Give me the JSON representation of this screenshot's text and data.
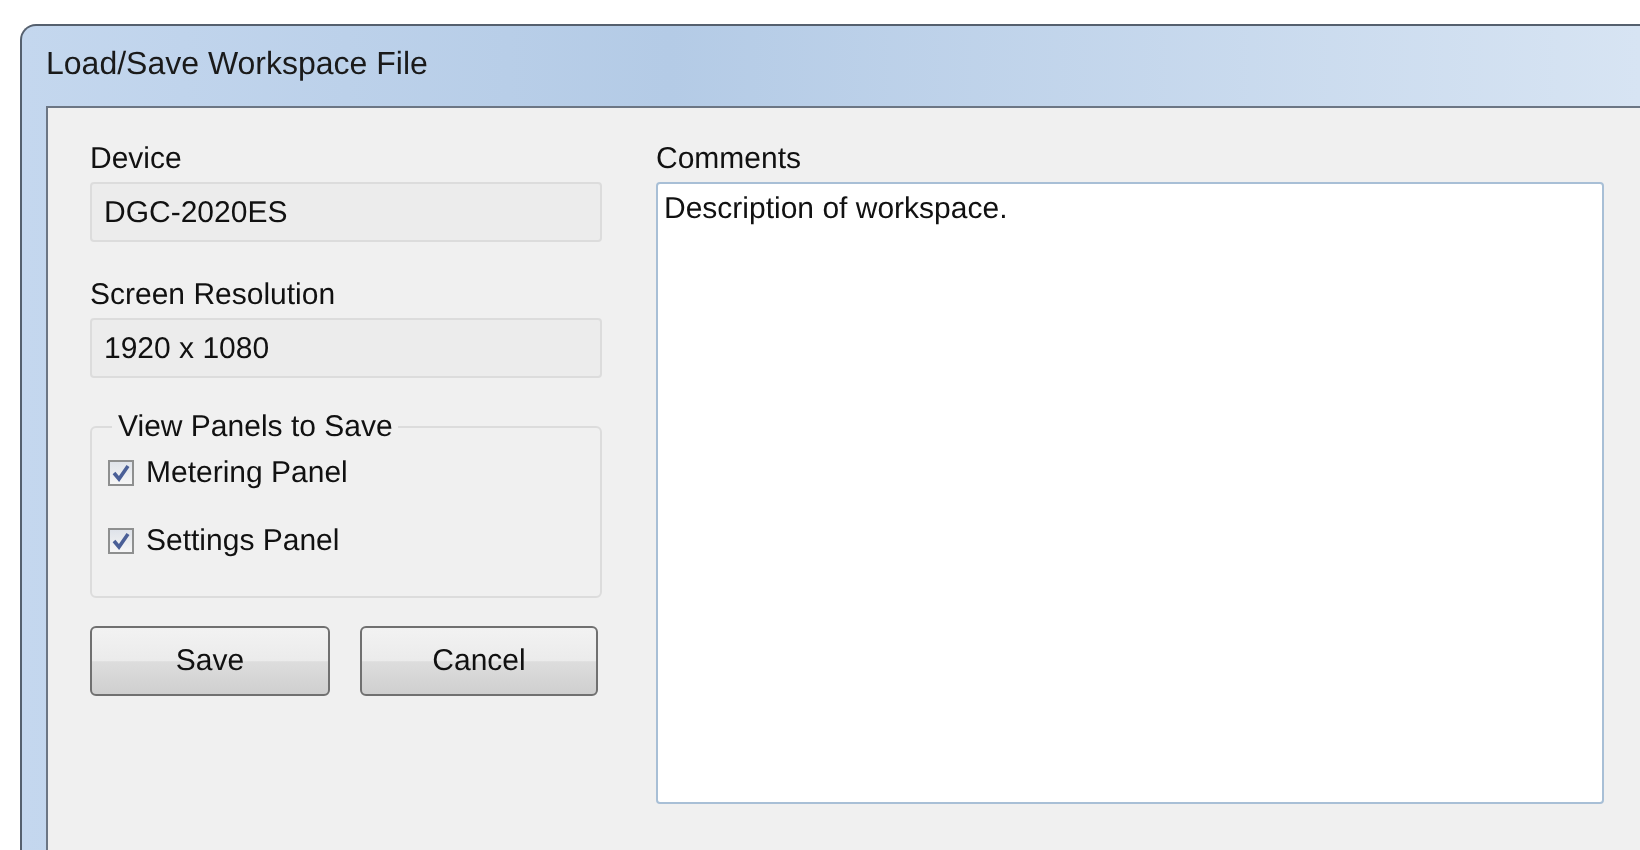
{
  "window": {
    "title": "Load/Save Workspace File"
  },
  "device": {
    "label": "Device",
    "value": "DGC-2020ES"
  },
  "screen_resolution": {
    "label": "Screen Resolution",
    "value": "1920 x 1080"
  },
  "view_panels": {
    "title": "View Panels to Save",
    "options": [
      {
        "label": "Metering Panel",
        "checked": true
      },
      {
        "label": "Settings Panel",
        "checked": true
      }
    ]
  },
  "buttons": [
    {
      "label": "Save"
    },
    {
      "label": "Cancel"
    }
  ],
  "comments": {
    "label": "Comments",
    "value": "Description of workspace."
  }
}
